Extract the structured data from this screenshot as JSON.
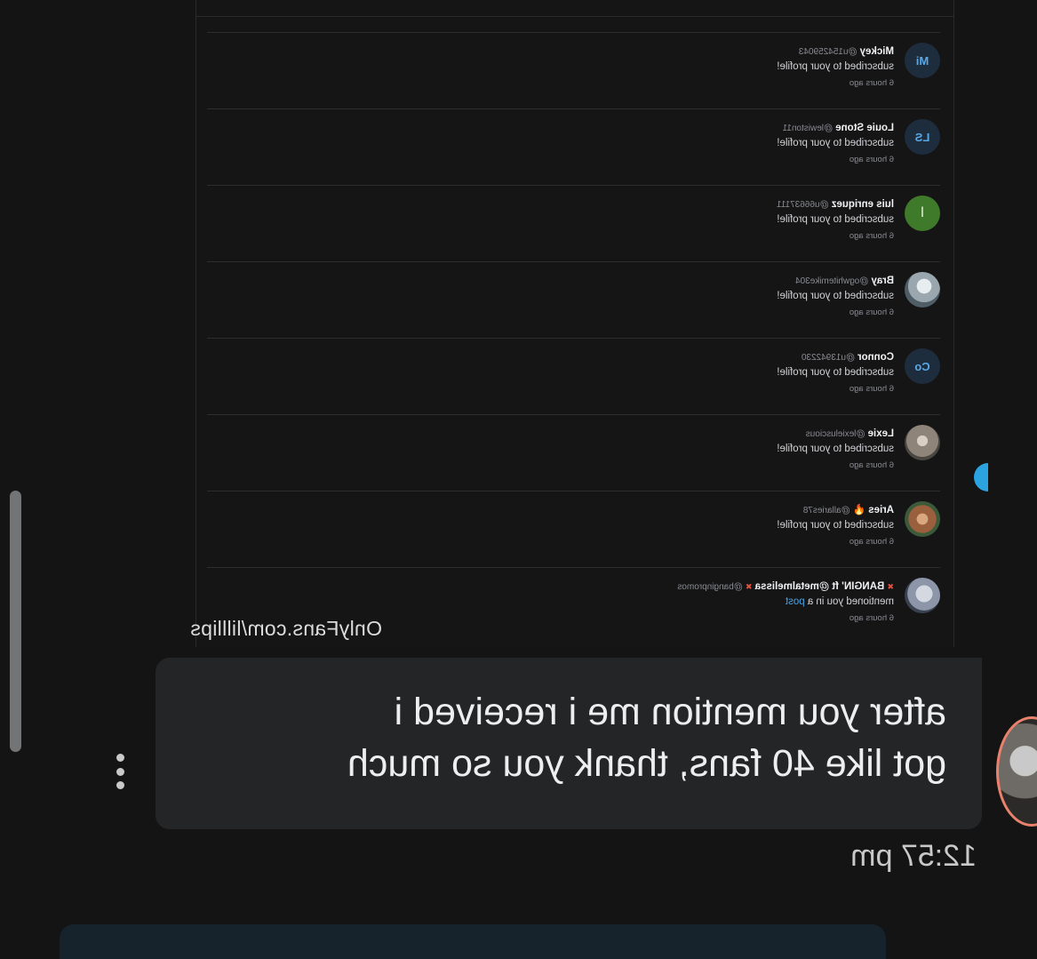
{
  "app": {
    "watermark": "OnlyFans.com/lilllips"
  },
  "notifications": [
    {
      "avatar_type": "initials",
      "avatar_text": "Mi",
      "name": "Mickey",
      "handle": "@u154259043",
      "action": "subscribed to your profile!",
      "time": "6 hours ago"
    },
    {
      "avatar_type": "initials",
      "avatar_text": "LS",
      "name": "Louie Stone",
      "handle": "@lewiston11",
      "action": "subscribed to your profile!",
      "time": "6 hours ago"
    },
    {
      "avatar_type": "letter",
      "avatar_text": "l",
      "name": "luis enriquez",
      "handle": "@u66637111",
      "action": "subscribed to your profile!",
      "time": "6 hours ago"
    },
    {
      "avatar_type": "photo-a",
      "avatar_text": "",
      "name": "Bray",
      "handle": "@ogwhitemike304",
      "action": "subscribed to your profile!",
      "time": "6 hours ago"
    },
    {
      "avatar_type": "initials",
      "avatar_text": "Co",
      "name": "Connor",
      "handle": "@u13942230",
      "action": "subscribed to your profile!",
      "time": "6 hours ago"
    },
    {
      "avatar_type": "photo-b",
      "avatar_text": "",
      "name": "Lexie",
      "handle": "@lexieluscious",
      "action": "subscribed to your profile!",
      "time": "6 hours ago"
    },
    {
      "avatar_type": "photo-c",
      "avatar_text": "",
      "name": "Aries 🔥",
      "handle": "@allaries78",
      "action": "subscribed to your profile!",
      "time": "6 hours ago"
    },
    {
      "avatar_type": "photo-d",
      "avatar_text": "",
      "name": "BANGIN' ft @metalmelissa",
      "flag": "✖",
      "handle": "@banginpromos",
      "action": "mentioned you in a",
      "link": "post",
      "time": "6 hours ago"
    }
  ],
  "message": {
    "text": "after you mention me i received i\ngot like 40 fans, thank you so much",
    "time": "12:57 pm"
  }
}
